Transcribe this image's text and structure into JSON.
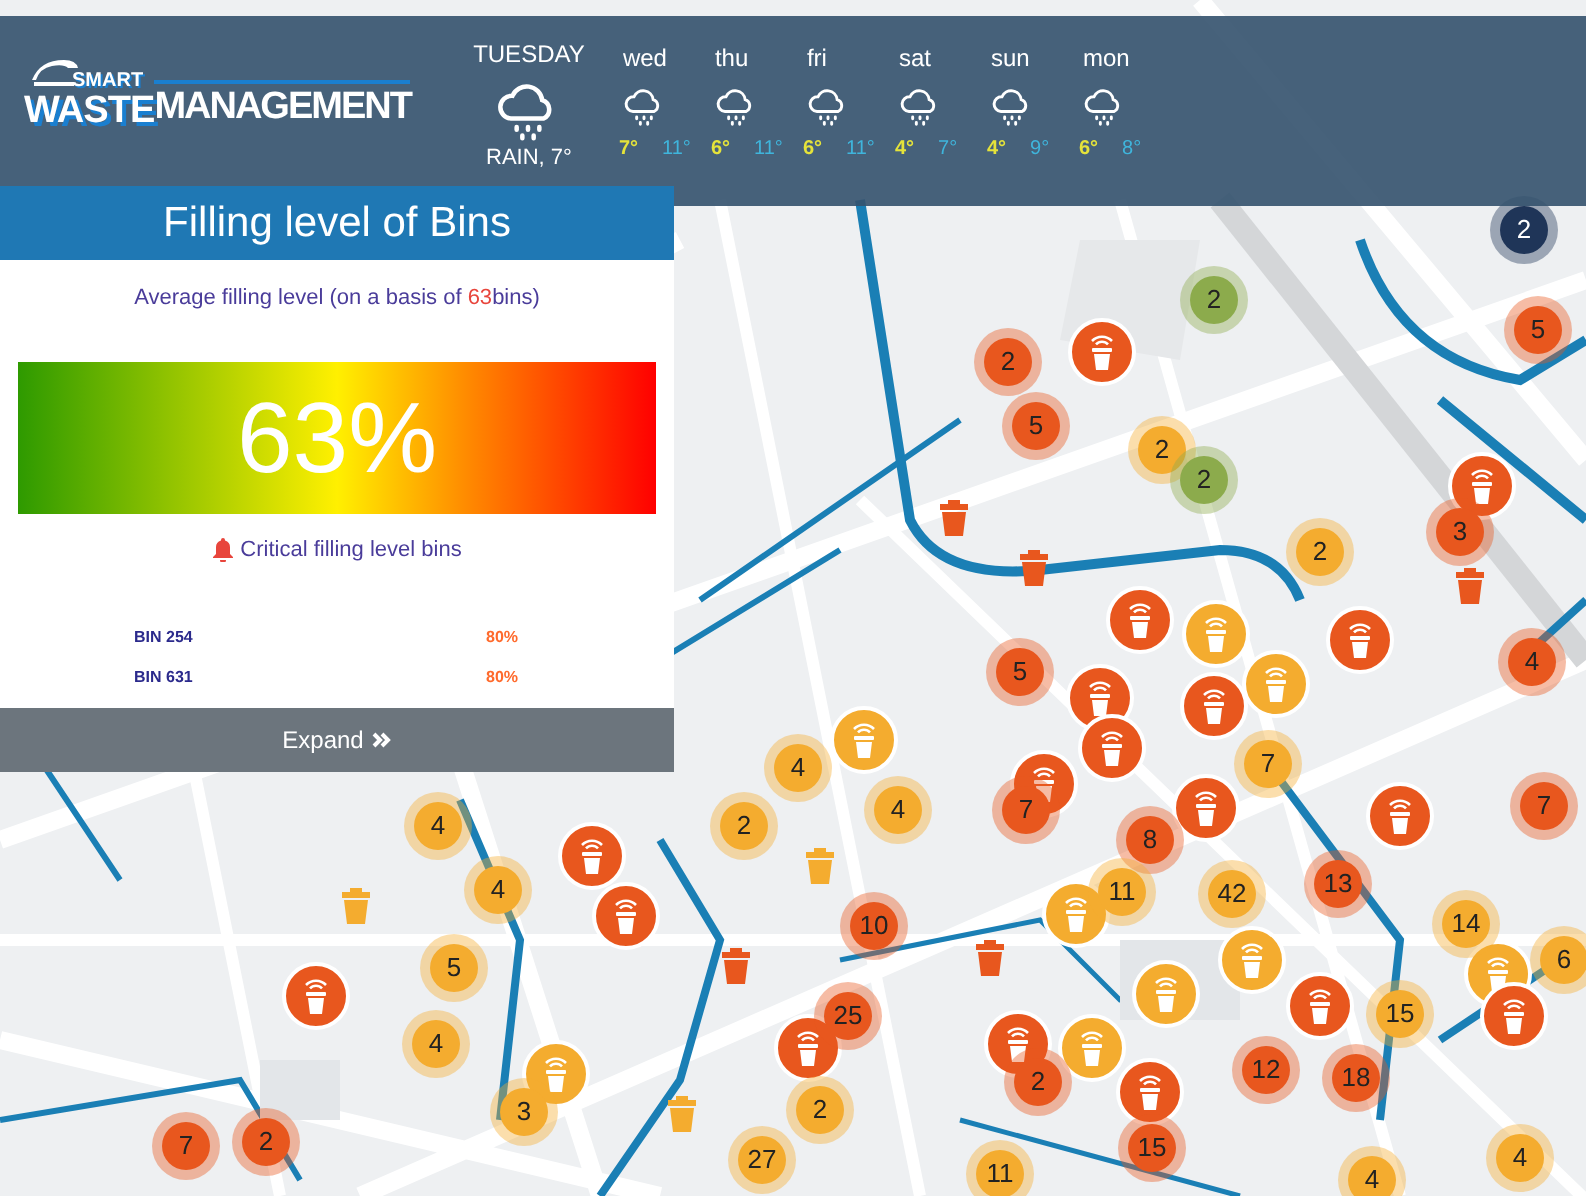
{
  "header": {
    "logo": {
      "top": "SMART",
      "bottom": "WASTE",
      "main": "MANAGEMENT"
    },
    "today": {
      "day": "TUESDAY",
      "summary": "RAIN, 7°"
    },
    "forecast": [
      {
        "day": "wed",
        "high": "7°",
        "low": "11°"
      },
      {
        "day": "thu",
        "high": "6°",
        "low": "11°"
      },
      {
        "day": "fri",
        "high": "6°",
        "low": "11°"
      },
      {
        "day": "sat",
        "high": "4°",
        "low": "7°"
      },
      {
        "day": "sun",
        "high": "4°",
        "low": "9°"
      },
      {
        "day": "mon",
        "high": "6°",
        "low": "8°"
      }
    ]
  },
  "panel": {
    "title": "Filling level of Bins",
    "subtitle_before": "Average filling level (on a basis of ",
    "subtitle_count": "63",
    "subtitle_after": "bins)",
    "average": "63%",
    "critical_label": "Critical filling level bins",
    "critical_bins": [
      {
        "name": "BIN 254",
        "level_text": "80%"
      },
      {
        "name": "BIN 631",
        "level_text": "80%"
      }
    ],
    "expand_button": "Expand"
  },
  "cluster_markers": [
    {
      "count": "2",
      "color": "#1f3558"
    },
    {
      "count": "2",
      "color": "#8cab4c"
    },
    {
      "count": "5",
      "color": "#e8571e"
    },
    {
      "count": "2",
      "color": "#e8571e"
    },
    {
      "count": "5",
      "color": "#e8571e"
    },
    {
      "count": "2",
      "color": "#f4ac2f"
    },
    {
      "count": "2",
      "color": "#8cab4c"
    },
    {
      "count": "2",
      "color": "#f4ac2f"
    },
    {
      "count": "3",
      "color": "#e8571e"
    },
    {
      "count": "5",
      "color": "#e8571e"
    },
    {
      "count": "4",
      "color": "#e8571e"
    },
    {
      "count": "4",
      "color": "#f4ac2f"
    },
    {
      "count": "7",
      "color": "#f4ac2f"
    },
    {
      "count": "4",
      "color": "#f4ac2f"
    },
    {
      "count": "2",
      "color": "#f4ac2f"
    },
    {
      "count": "4",
      "color": "#f4ac2f"
    },
    {
      "count": "7",
      "color": "#e8571e"
    },
    {
      "count": "8",
      "color": "#e8571e"
    },
    {
      "count": "7",
      "color": "#e8571e"
    },
    {
      "count": "4",
      "color": "#f4ac2f"
    },
    {
      "count": "11",
      "color": "#f4ac2f"
    },
    {
      "count": "42",
      "color": "#f4ac2f"
    },
    {
      "count": "13",
      "color": "#e8571e"
    },
    {
      "count": "10",
      "color": "#e8571e"
    },
    {
      "count": "14",
      "color": "#f4ac2f"
    },
    {
      "count": "5",
      "color": "#f4ac2f"
    },
    {
      "count": "6",
      "color": "#f4ac2f"
    },
    {
      "count": "25",
      "color": "#e8571e"
    },
    {
      "count": "15",
      "color": "#f4ac2f"
    },
    {
      "count": "4",
      "color": "#f4ac2f"
    },
    {
      "count": "2",
      "color": "#e8571e"
    },
    {
      "count": "12",
      "color": "#e8571e"
    },
    {
      "count": "18",
      "color": "#e8571e"
    },
    {
      "count": "3",
      "color": "#f4ac2f"
    },
    {
      "count": "2",
      "color": "#f4ac2f"
    },
    {
      "count": "7",
      "color": "#e8571e"
    },
    {
      "count": "2",
      "color": "#e8571e"
    },
    {
      "count": "27",
      "color": "#f4ac2f"
    },
    {
      "count": "11",
      "color": "#f4ac2f"
    },
    {
      "count": "15",
      "color": "#e8571e"
    },
    {
      "count": "4",
      "color": "#f4ac2f"
    },
    {
      "count": "4",
      "color": "#f4ac2f"
    }
  ],
  "sensor_markers": [
    {
      "color": "#e8571e"
    },
    {
      "color": "#e8571e"
    },
    {
      "color": "#e8571e"
    },
    {
      "color": "#f4ac2f"
    },
    {
      "color": "#e8571e"
    },
    {
      "color": "#f4ac2f"
    },
    {
      "color": "#e8571e"
    },
    {
      "color": "#e8571e"
    },
    {
      "color": "#f4ac2f"
    },
    {
      "color": "#e8571e"
    },
    {
      "color": "#e8571e"
    },
    {
      "color": "#e8571e"
    },
    {
      "color": "#e8571e"
    },
    {
      "color": "#e8571e"
    },
    {
      "color": "#e8571e"
    },
    {
      "color": "#f4ac2f"
    },
    {
      "color": "#f4ac2f"
    },
    {
      "color": "#f4ac2f"
    },
    {
      "color": "#f4ac2f"
    },
    {
      "color": "#e8571e"
    },
    {
      "color": "#e8571e"
    },
    {
      "color": "#e8571e"
    },
    {
      "color": "#e8571e"
    },
    {
      "color": "#e8571e"
    },
    {
      "color": "#f4ac2f"
    },
    {
      "color": "#f4ac2f"
    },
    {
      "color": "#e8571e"
    }
  ],
  "bin_markers": [
    {
      "color": "#e8571e"
    },
    {
      "color": "#e8571e"
    },
    {
      "color": "#e8571e"
    },
    {
      "color": "#f4ac2f"
    },
    {
      "color": "#f4ac2f"
    },
    {
      "color": "#e8571e"
    },
    {
      "color": "#e8571e"
    },
    {
      "color": "#f4ac2f"
    }
  ]
}
